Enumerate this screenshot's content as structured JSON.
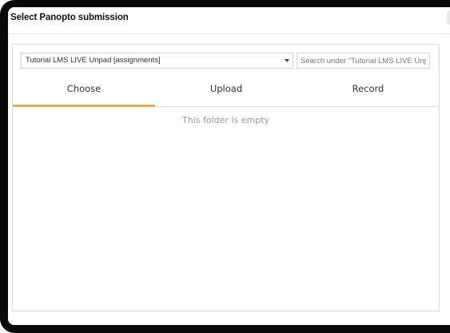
{
  "dialog": {
    "title": "Select Panopto submission"
  },
  "folder_select": {
    "selected": "Tutorial LMS LIVE Unpad  [assignments]"
  },
  "search": {
    "placeholder": "Search under \"Tutorial LMS LIVE Unp",
    "value": ""
  },
  "tabs": [
    {
      "label": "Choose",
      "active": true
    },
    {
      "label": "Upload",
      "active": false
    },
    {
      "label": "Record",
      "active": false
    }
  ],
  "content": {
    "empty_message": "This folder is empty"
  },
  "colors": {
    "active_tab_accent": "#f0ad1c",
    "frame": "#0a0a0a",
    "empty_text": "#9a9a9a"
  },
  "icons": {
    "select_caret": "caret-down-icon"
  }
}
